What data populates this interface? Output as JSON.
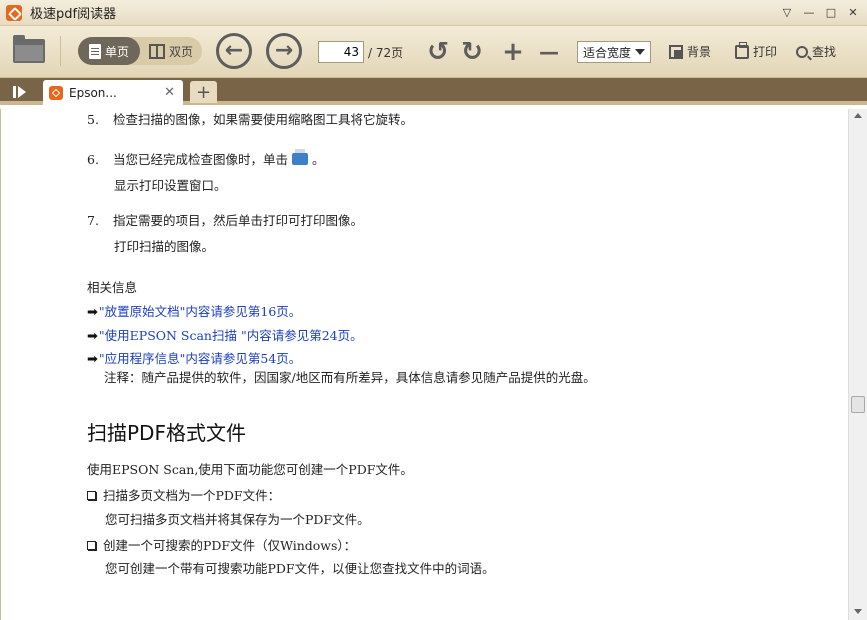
{
  "window": {
    "title": "极速pdf阅读器",
    "controls": [
      "▽",
      "—",
      "□",
      "✕"
    ]
  },
  "toolbar": {
    "single_label": "单页",
    "double_label": "双页",
    "prev_glyph": "←",
    "next_glyph": "→",
    "current_page": "43",
    "total_pages": "/ 72页",
    "rotate_left_glyph": "↺",
    "rotate_right_glyph": "↻",
    "zoom_in_glyph": "+",
    "zoom_out_glyph": "—",
    "fit_mode": "适合宽度",
    "background_label": "背景",
    "print_label": "打印",
    "search_label": "查找"
  },
  "tabs": {
    "active_tab_label": "Epson...",
    "close_glyph": "✕",
    "new_tab_glyph": "+"
  },
  "document": {
    "steps": [
      {
        "num": "5.",
        "text": "检查扫描的图像，如果需要使用缩略图工具将它旋转。"
      },
      {
        "num": "6.",
        "text_before_icon": "当您已经完成检查图像时，单击",
        "text_after_icon": "。",
        "detail": "显示打印设置窗口。"
      },
      {
        "num": "7.",
        "text": "指定需要的项目，然后单击打印可打印图像。",
        "detail": "打印扫描的图像。"
      }
    ],
    "related_title": "相关信息",
    "links": [
      "\"放置原始文档\"内容请参见第16页。",
      "\"使用EPSON Scan扫描 \"内容请参见第24页。",
      "\"应用程序信息\"内容请参见第54页。"
    ],
    "note": "注释：随产品提供的软件，因国家/地区而有所差异，具体信息请参见随产品提供的光盘。",
    "section_title": "扫描PDF格式文件",
    "intro": "使用EPSON Scan,使用下面功能您可创建一个PDF文件。",
    "bullets": [
      {
        "title": "扫描多页文档为一个PDF文件：",
        "detail": "您可扫描多页文档并将其保存为一个PDF文件。"
      },
      {
        "title": "创建一个可搜索的PDF文件（仅Windows）：",
        "detail": "您可创建一个带有可搜索功能PDF文件，以便让您查找文件中的词语。"
      }
    ],
    "link_color": "#1a3fc1"
  },
  "colors": {
    "accent_orange": "#e8671c",
    "tab_bar": "#7a6448",
    "toolbar_bg": "#e3d6b7"
  }
}
